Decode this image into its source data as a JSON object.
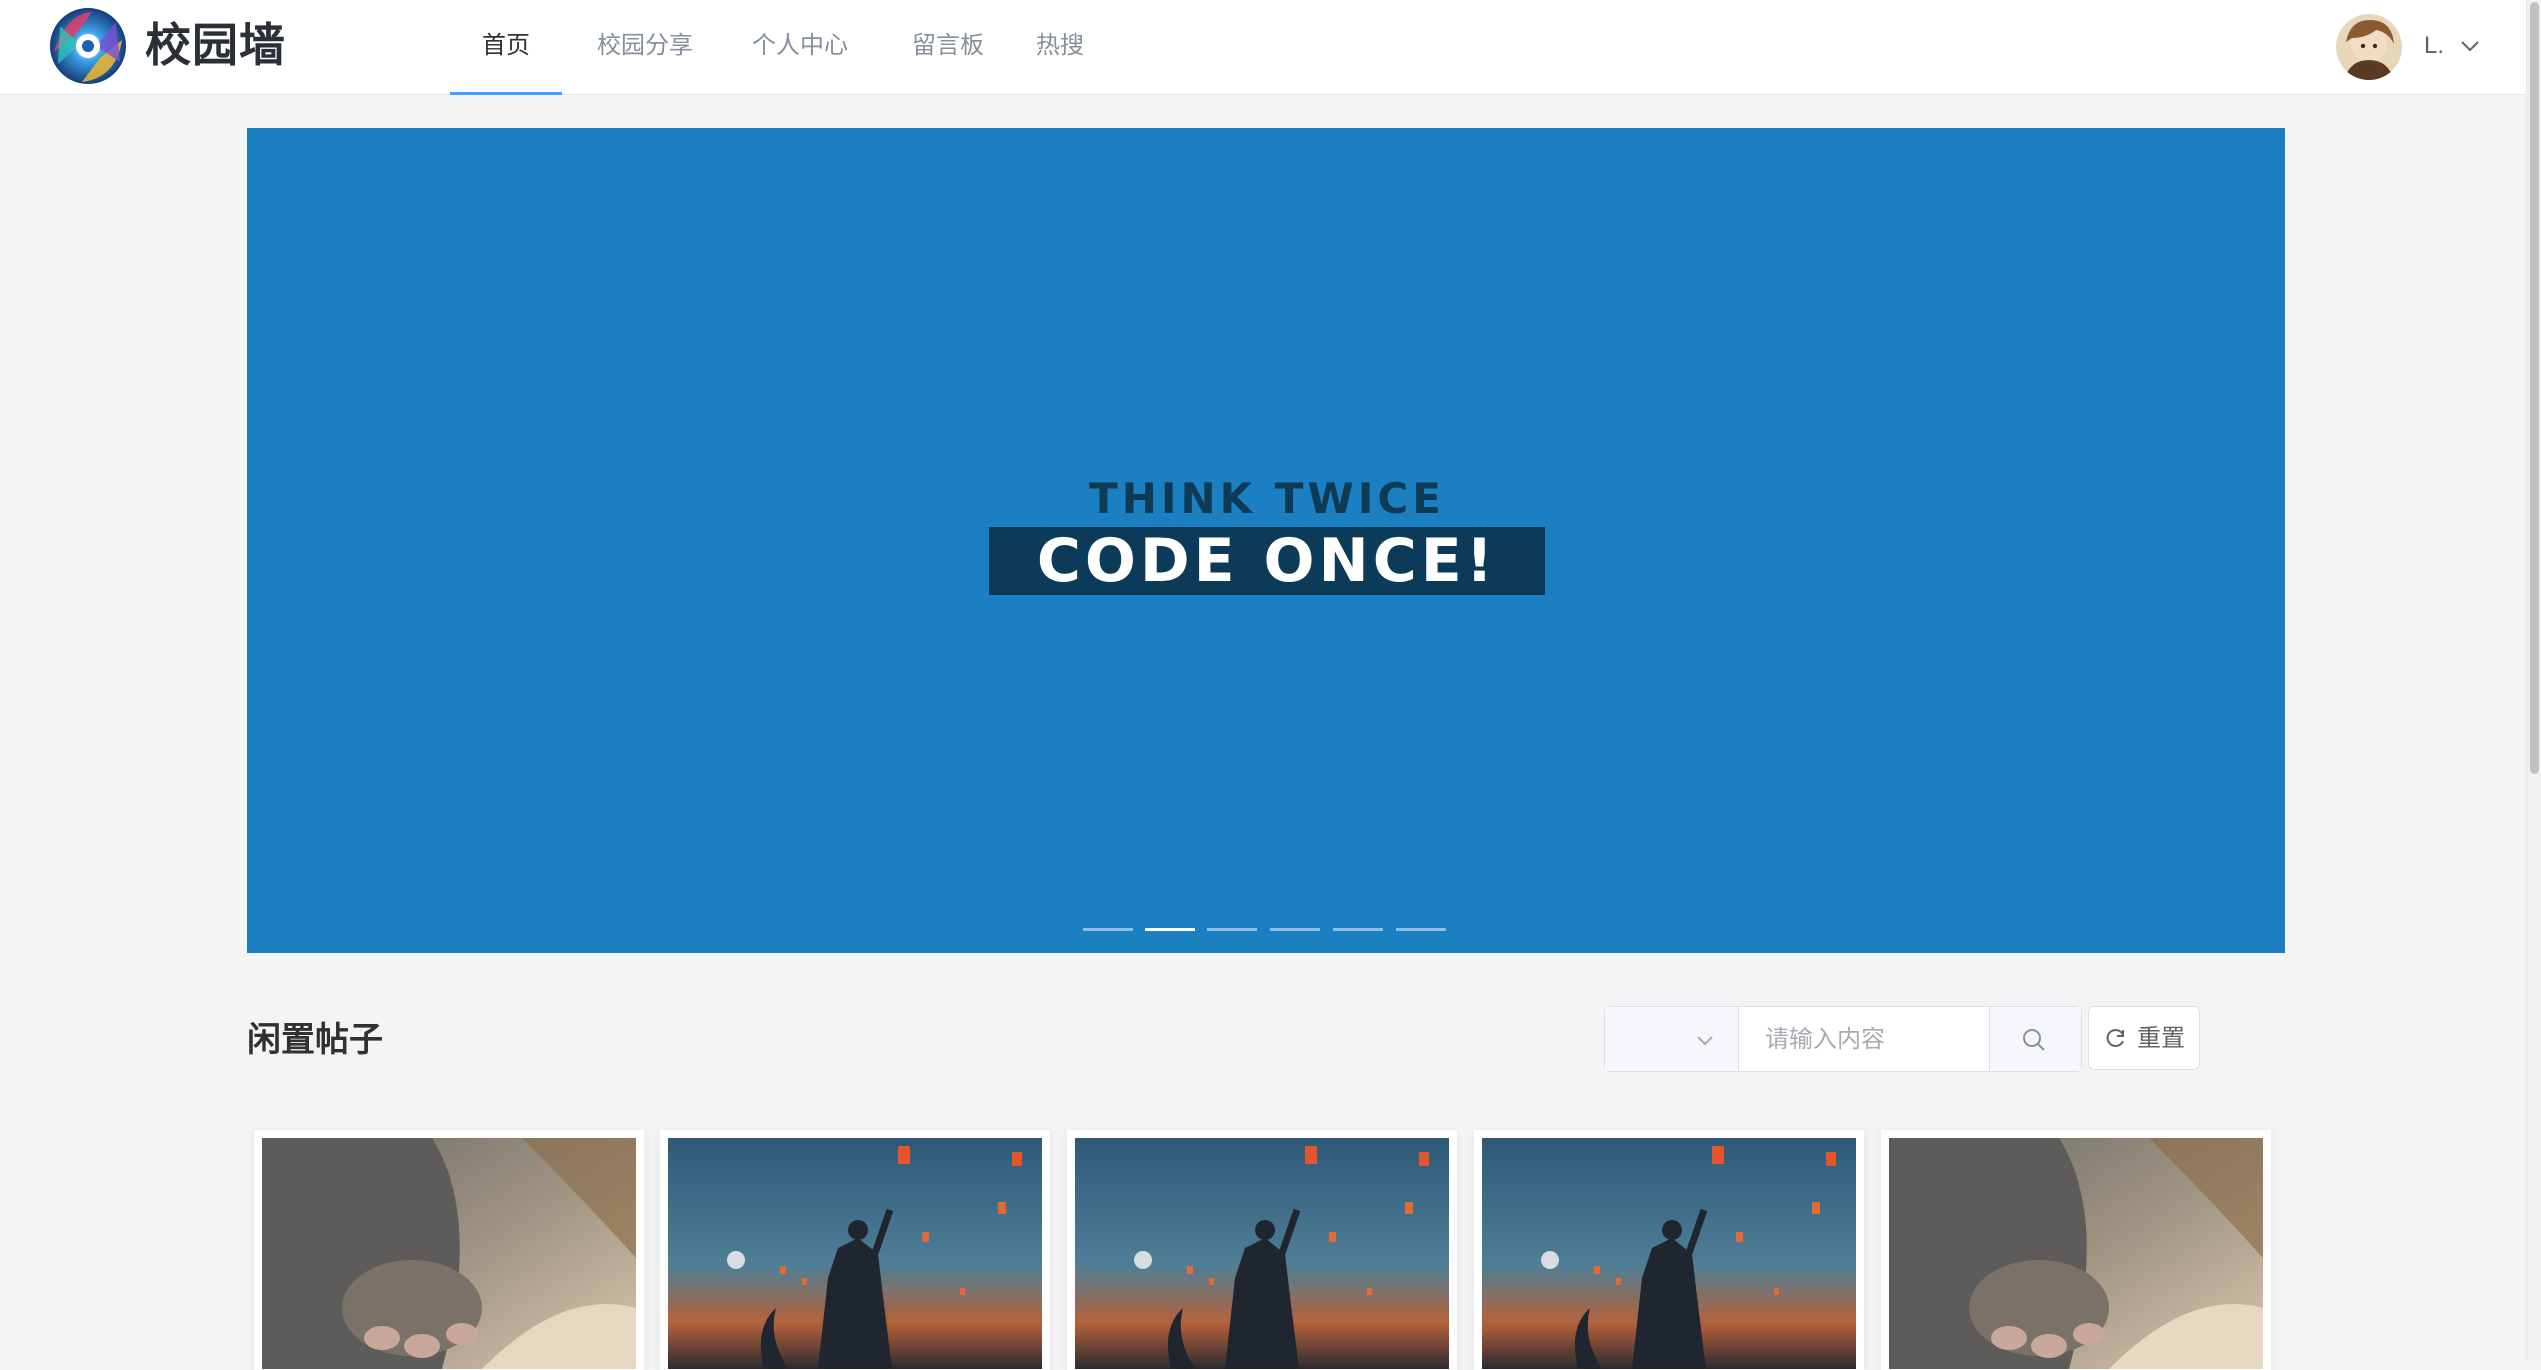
{
  "header": {
    "brand": "校园墙",
    "nav": [
      {
        "label": "首页",
        "active": true
      },
      {
        "label": "校园分享",
        "active": false
      },
      {
        "label": "个人中心",
        "active": false
      },
      {
        "label": "留言板",
        "active": false
      },
      {
        "label": "热搜",
        "active": false
      }
    ],
    "user": {
      "name": "L."
    }
  },
  "carousel": {
    "slogan_top": "THINK TWICE",
    "slogan_bottom": "CODE ONCE!",
    "slide_count": 6,
    "active_index": 1,
    "background": "#1a80c1"
  },
  "section": {
    "title": "闲置帖子",
    "search_placeholder": "请输入内容",
    "select_value": "",
    "reset_label": "重置"
  },
  "posts": [
    {
      "image": "cat-paw-photo"
    },
    {
      "image": "lantern-warrior-photo"
    },
    {
      "image": "lantern-warrior-photo"
    },
    {
      "image": "lantern-warrior-photo"
    },
    {
      "image": "cat-paw-photo"
    }
  ],
  "colors": {
    "accent": "#409eff",
    "page_bg": "#f3f4f6"
  }
}
